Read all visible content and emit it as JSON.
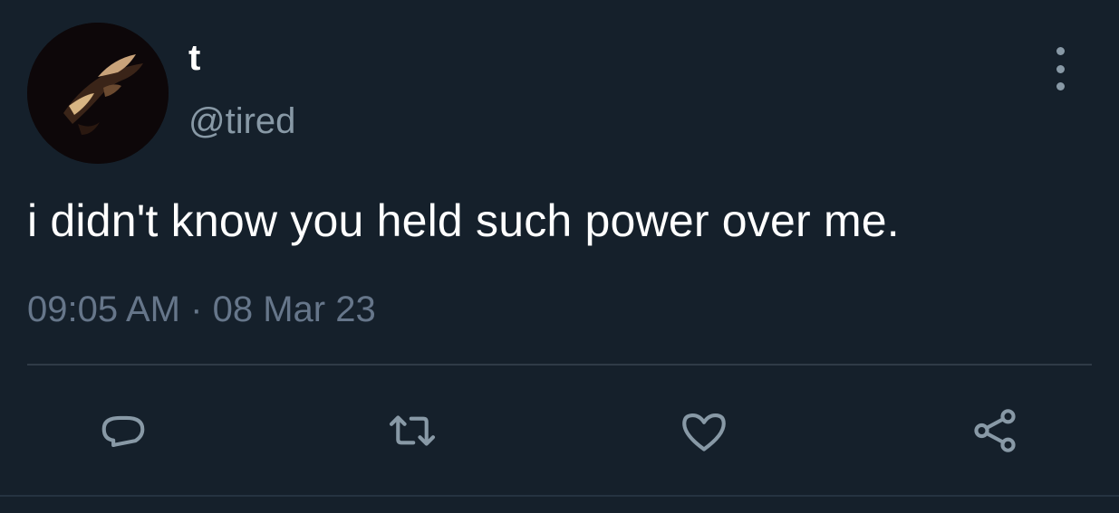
{
  "user": {
    "display_name": "t",
    "handle": "@tired",
    "avatar_icon": "profile-photo"
  },
  "tweet": {
    "text": "i didn't know you held such power over me.",
    "time": "09:05 AM",
    "separator": "·",
    "date": "08 Mar 23"
  },
  "actions": [
    {
      "name": "reply",
      "icon": "speech-bubble-icon"
    },
    {
      "name": "retweet",
      "icon": "retweet-icon"
    },
    {
      "name": "like",
      "icon": "heart-icon"
    },
    {
      "name": "share",
      "icon": "share-icon"
    }
  ],
  "colors": {
    "background": "#15202b",
    "primary_text": "#ffffff",
    "secondary_text": "#8899a6",
    "icon": "#8899a6",
    "divider": "#2f3b47"
  }
}
